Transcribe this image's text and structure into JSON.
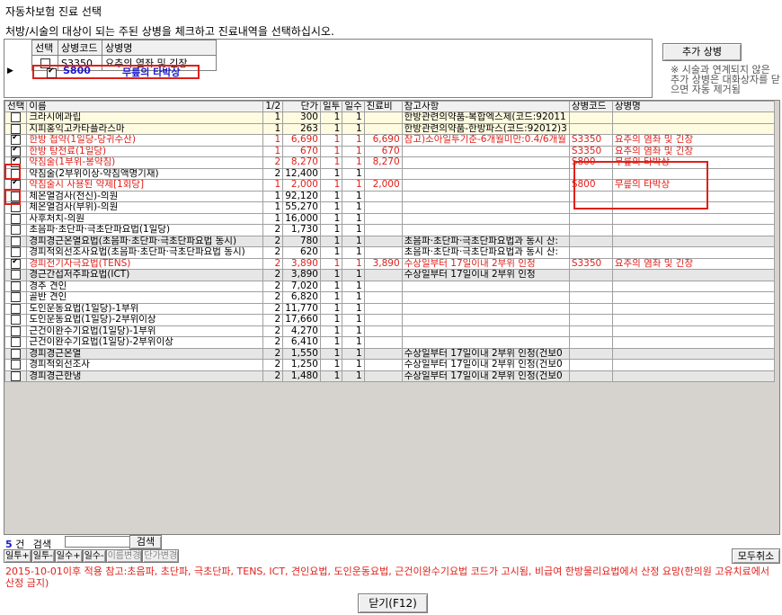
{
  "window": {
    "title": "자동차보험 진료 선택",
    "instruction": "처방/시술의 대상이 되는 주된 상병을 체크하고 진료내역을 선택하십시오."
  },
  "disease_grid": {
    "headers": [
      "선택",
      "상병코드",
      "상병명"
    ],
    "rows": [
      {
        "checked": false,
        "code": "S3350",
        "name": "요추의 염좌 및 긴장"
      },
      {
        "checked": true,
        "code": "S800",
        "name": "무릎의 타박상"
      }
    ]
  },
  "side_panel": {
    "add_button": "추가 상병",
    "note": "※ 시술과 연계되지 않은 추가 상병은 대화상자를 닫으면 자동 제거됨"
  },
  "treatment_grid": {
    "headers": [
      "선택",
      "이름",
      "1/2",
      "단가",
      "일투",
      "일수",
      "진료비",
      "참고사항",
      "상병코드",
      "상병명"
    ],
    "rows": [
      {
        "checked": false,
        "name": "크라시에과립",
        "half": "1",
        "price": "300",
        "daily": "1",
        "days": "1",
        "fee": "",
        "note": "한방관련의약품-복합엑스제(코드:92011",
        "code": "",
        "dname": "",
        "style": "yellow"
      },
      {
        "checked": false,
        "name": "지피홍익고카타플라스마",
        "half": "1",
        "price": "263",
        "daily": "1",
        "days": "1",
        "fee": "",
        "note": "한방관련의약품-한방파스(코드:92012)3",
        "code": "",
        "dname": "",
        "style": "yellow"
      },
      {
        "checked": true,
        "name": "한방 첩약(1일당-당귀수산)",
        "half": "1",
        "price": "6,690",
        "daily": "1",
        "days": "1",
        "fee": "6,690",
        "note": "참고)소아일투기준-6개월미만:0.4/6개월",
        "code": "S3350",
        "dname": "요추의 염좌 및 긴장",
        "style": "red"
      },
      {
        "checked": true,
        "name": "한방 탕전료(1일당)",
        "half": "1",
        "price": "670",
        "daily": "1",
        "days": "1",
        "fee": "670",
        "note": "",
        "code": "S3350",
        "dname": "요추의 염좌 및 긴장",
        "style": "red"
      },
      {
        "checked": true,
        "name": "약침술(1부위-봉약침)",
        "half": "2",
        "price": "8,270",
        "daily": "1",
        "days": "1",
        "fee": "8,270",
        "note": "",
        "code": "S800",
        "dname": "무릎의 타박상",
        "style": "red",
        "box": true
      },
      {
        "checked": false,
        "name": "약침술(2부위이상-약침액명기재)",
        "half": "2",
        "price": "12,400",
        "daily": "1",
        "days": "1",
        "fee": "",
        "note": "",
        "code": "",
        "dname": "",
        "style": ""
      },
      {
        "checked": true,
        "name": "약침술시 사용된 약제[1회당]",
        "half": "1",
        "price": "2,000",
        "daily": "1",
        "days": "1",
        "fee": "2,000",
        "note": "",
        "code": "S800",
        "dname": "무릎의 타박상",
        "style": "red",
        "box": true
      },
      {
        "checked": false,
        "name": "체온열검사(전신)-의원",
        "half": "1",
        "price": "92,120",
        "daily": "1",
        "days": "1",
        "fee": "",
        "note": "",
        "code": "",
        "dname": "",
        "style": ""
      },
      {
        "checked": false,
        "name": "체온열검사(부위)-의원",
        "half": "1",
        "price": "55,270",
        "daily": "1",
        "days": "1",
        "fee": "",
        "note": "",
        "code": "",
        "dname": "",
        "style": ""
      },
      {
        "checked": false,
        "name": "사후처치-의원",
        "half": "1",
        "price": "16,000",
        "daily": "1",
        "days": "1",
        "fee": "",
        "note": "",
        "code": "",
        "dname": "",
        "style": ""
      },
      {
        "checked": false,
        "name": "초음파·초단파·극초단파요법(1일당)",
        "half": "2",
        "price": "1,730",
        "daily": "1",
        "days": "1",
        "fee": "",
        "note": "",
        "code": "",
        "dname": "",
        "style": ""
      },
      {
        "checked": false,
        "name": "경피경근온열요법(초음파·초단파·극초단파요법 동시)",
        "half": "2",
        "price": "780",
        "daily": "1",
        "days": "1",
        "fee": "",
        "note": "초음파·초단파·극초단파요법과 동시 산:",
        "code": "",
        "dname": "",
        "style": "gray"
      },
      {
        "checked": false,
        "name": "경피적외선조사요법(초음파·초단파·극초단파요법 동시)",
        "half": "2",
        "price": "620",
        "daily": "1",
        "days": "1",
        "fee": "",
        "note": "초음파·초단파·극초단파요법과 동시 산:",
        "code": "",
        "dname": "",
        "style": ""
      },
      {
        "checked": true,
        "name": "경피전기자극요법(TENS)",
        "half": "2",
        "price": "3,890",
        "daily": "1",
        "days": "1",
        "fee": "3,890",
        "note": "수상일부터 17일이내 2부위 인정",
        "code": "S3350",
        "dname": "요추의 염좌 및 긴장",
        "style": "red"
      },
      {
        "checked": false,
        "name": "경근간섭저주파요법(ICT)",
        "half": "2",
        "price": "3,890",
        "daily": "1",
        "days": "1",
        "fee": "",
        "note": "수상일부터 17일이내 2부위 인정",
        "code": "",
        "dname": "",
        "style": "gray"
      },
      {
        "checked": false,
        "name": "경추 견인",
        "half": "2",
        "price": "7,020",
        "daily": "1",
        "days": "1",
        "fee": "",
        "note": "",
        "code": "",
        "dname": "",
        "style": ""
      },
      {
        "checked": false,
        "name": "골반 견인",
        "half": "2",
        "price": "6,820",
        "daily": "1",
        "days": "1",
        "fee": "",
        "note": "",
        "code": "",
        "dname": "",
        "style": ""
      },
      {
        "checked": false,
        "name": "도인운동요법(1일당)-1부위",
        "half": "2",
        "price": "11,770",
        "daily": "1",
        "days": "1",
        "fee": "",
        "note": "",
        "code": "",
        "dname": "",
        "style": ""
      },
      {
        "checked": false,
        "name": "도인운동요법(1일당)-2부위이상",
        "half": "2",
        "price": "17,660",
        "daily": "1",
        "days": "1",
        "fee": "",
        "note": "",
        "code": "",
        "dname": "",
        "style": ""
      },
      {
        "checked": false,
        "name": "근건이완수기요법(1일당)-1부위",
        "half": "2",
        "price": "4,270",
        "daily": "1",
        "days": "1",
        "fee": "",
        "note": "",
        "code": "",
        "dname": "",
        "style": ""
      },
      {
        "checked": false,
        "name": "근건이완수기요법(1일당)-2부위이상",
        "half": "2",
        "price": "6,410",
        "daily": "1",
        "days": "1",
        "fee": "",
        "note": "",
        "code": "",
        "dname": "",
        "style": ""
      },
      {
        "checked": false,
        "name": "경피경근온열",
        "half": "2",
        "price": "1,550",
        "daily": "1",
        "days": "1",
        "fee": "",
        "note": "수상일부터 17일이내 2부위 인정(건보0",
        "code": "",
        "dname": "",
        "style": "gray"
      },
      {
        "checked": false,
        "name": "경피적외선조사",
        "half": "2",
        "price": "1,250",
        "daily": "1",
        "days": "1",
        "fee": "",
        "note": "수상일부터 17일이내 2부위 인정(건보0",
        "code": "",
        "dname": "",
        "style": ""
      },
      {
        "checked": false,
        "name": "경피경근한냉",
        "half": "2",
        "price": "1,480",
        "daily": "1",
        "days": "1",
        "fee": "",
        "note": "수상일부터 17일이내 2부위 인정(건보0",
        "code": "",
        "dname": "",
        "style": "gray"
      }
    ]
  },
  "search": {
    "count": "5",
    "count_suffix": "건",
    "label": "검색",
    "value": "",
    "button": "검색"
  },
  "toolbar": {
    "buttons": [
      "일투+",
      "일투-",
      "일수+",
      "일수-",
      "이름변경",
      "단가변경"
    ],
    "clear_all": "모두취소"
  },
  "warning": "2015-10-01이후 적용 참고:초음파, 초단파, 극초단파, TENS, ICT, 견인요법, 도인운동요법, 근건이완수기요법 코드가 고시됨, 비급여 한방물리요법에서 산정 요망(한의원 고유치료에서 산정 금지)",
  "close_button": "닫기(F12)"
}
